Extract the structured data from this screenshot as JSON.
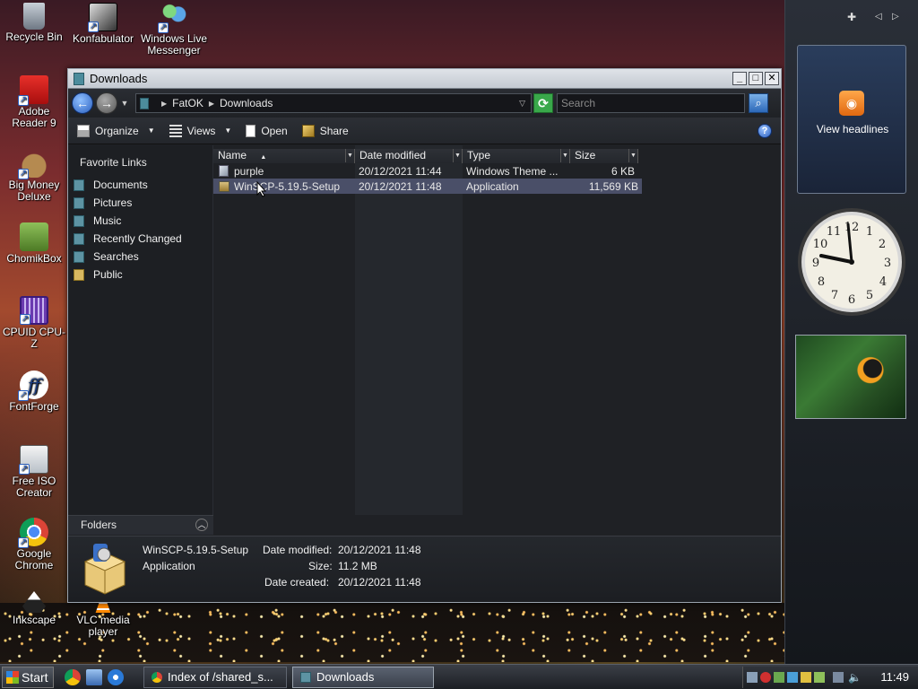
{
  "desktop": {
    "icons": [
      {
        "label": "Recycle Bin"
      },
      {
        "label": "Konfabulator"
      },
      {
        "label": "Windows Live Messenger"
      },
      {
        "label": "Adobe Reader 9"
      },
      {
        "label": "Big Money Deluxe"
      },
      {
        "label": "ChomikBox"
      },
      {
        "label": "CPUID CPU-Z"
      },
      {
        "label": "FontForge"
      },
      {
        "label": "Free ISO Creator"
      },
      {
        "label": "Google Chrome"
      },
      {
        "label": "Inkscape"
      },
      {
        "label": "VLC media player"
      }
    ]
  },
  "window": {
    "title": "Downloads",
    "address": {
      "segments": [
        "FatOK",
        "Downloads"
      ]
    },
    "search_placeholder": "Search",
    "toolbar": {
      "organize": "Organize",
      "views": "Views",
      "open": "Open",
      "share": "Share"
    },
    "nav": {
      "title": "Favorite Links",
      "items": [
        "Documents",
        "Pictures",
        "Music",
        "Recently Changed",
        "Searches",
        "Public"
      ],
      "folders_label": "Folders"
    },
    "columns": [
      "Name",
      "Date modified",
      "Type",
      "Size"
    ],
    "files": [
      {
        "name": "purple",
        "date": "20/12/2021 11:44",
        "type": "Windows Theme ...",
        "size": "6 KB"
      },
      {
        "name": "WinSCP-5.19.5-Setup",
        "date": "20/12/2021 11:48",
        "type": "Application",
        "size": "11,569 KB"
      }
    ],
    "details": {
      "name": "WinSCP-5.19.5-Setup",
      "type": "Application",
      "date_modified_label": "Date modified:",
      "date_modified": "20/12/2021 11:48",
      "size_label": "Size:",
      "size": "11.2 MB",
      "date_created_label": "Date created:",
      "date_created": "20/12/2021 11:48"
    }
  },
  "sidebar": {
    "rss_label": "View headlines"
  },
  "taskbar": {
    "start_label": "Start",
    "tasks": [
      {
        "label": "Index of /shared_s..."
      },
      {
        "label": "Downloads"
      }
    ],
    "clock": "11:49"
  },
  "colors": {
    "accent": "#2a5fbf",
    "selection": "#4a4f68",
    "window_bg": "#1f2125"
  }
}
